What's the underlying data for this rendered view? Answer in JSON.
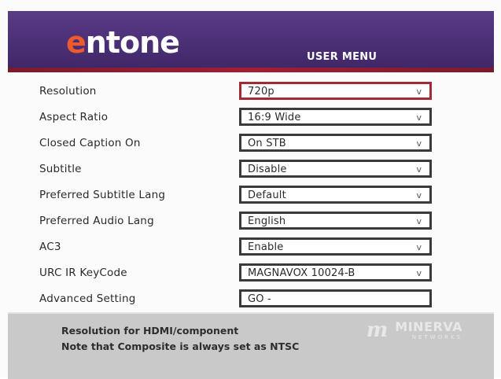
{
  "header": {
    "logo_text_1": "e",
    "logo_text_2": "ntone",
    "title": "USER MENU",
    "colors": {
      "band": "#4a2f75",
      "accent": "#a21f34",
      "logo_e": "#ee5a2b"
    }
  },
  "menu": {
    "rows": [
      {
        "label": "Resolution",
        "value": "720p",
        "has_dropdown": true,
        "focused": true
      },
      {
        "label": "Aspect Ratio",
        "value": "16:9 Wide",
        "has_dropdown": true
      },
      {
        "label": "Closed Caption On",
        "value": "On STB",
        "has_dropdown": true
      },
      {
        "label": "Subtitle",
        "value": "Disable",
        "has_dropdown": true
      },
      {
        "label": "Preferred Subtitle Lang",
        "value": "Default",
        "has_dropdown": true
      },
      {
        "label": "Preferred Audio Lang",
        "value": "English",
        "has_dropdown": true
      },
      {
        "label": "AC3",
        "value": "Enable",
        "has_dropdown": true
      },
      {
        "label": "URC IR KeyCode",
        "value": "MAGNAVOX 10024-B",
        "has_dropdown": true
      },
      {
        "label": "Advanced Setting",
        "value": "GO -",
        "has_dropdown": false
      }
    ],
    "dropdown_glyph": "v"
  },
  "footer": {
    "hint_line_1": "Resolution for HDMI/component",
    "hint_line_2": "Note that Composite is always set as NTSC",
    "brand_mark": "m",
    "brand_name": "MINERVA",
    "brand_sub": "NETWORKS"
  }
}
